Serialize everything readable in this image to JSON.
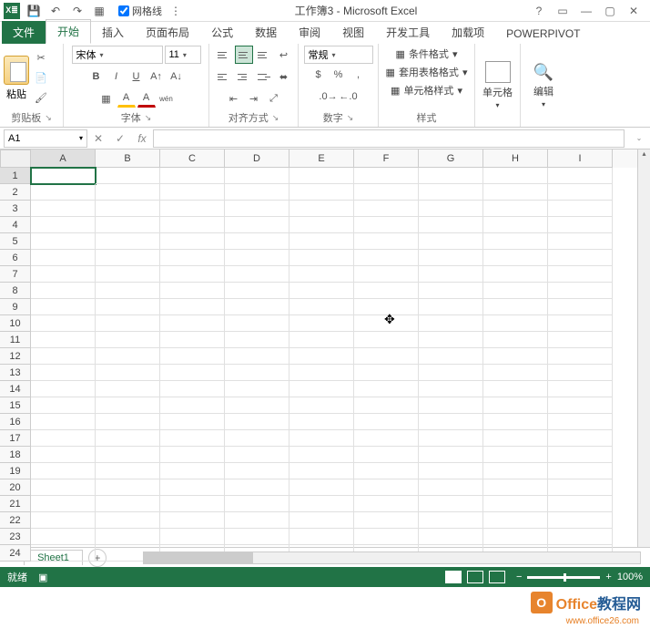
{
  "titlebar": {
    "gridlines_label": "网格线",
    "title": "工作簿3 - Microsoft Excel"
  },
  "tabs": {
    "file": "文件",
    "home": "开始",
    "insert": "插入",
    "pagelayout": "页面布局",
    "formulas": "公式",
    "data": "数据",
    "review": "审阅",
    "view": "视图",
    "developer": "开发工具",
    "addins": "加载项",
    "powerpivot": "POWERPIVOT"
  },
  "ribbon": {
    "clipboard": {
      "label": "剪贴板",
      "paste": "粘贴"
    },
    "font": {
      "label": "字体",
      "name": "宋体",
      "size": "11",
      "bold": "B",
      "italic": "I",
      "underline": "U",
      "phonetic": "wén",
      "phonetic2": "A"
    },
    "alignment": {
      "label": "对齐方式"
    },
    "number": {
      "label": "数字",
      "format": "常规"
    },
    "styles": {
      "label": "样式",
      "cond": "条件格式",
      "table": "套用表格格式",
      "cell": "单元格样式"
    },
    "cells": {
      "label": "单元格"
    },
    "editing": {
      "label": "编辑"
    }
  },
  "formula_bar": {
    "name_box": "A1",
    "fx": "fx"
  },
  "grid": {
    "cols": [
      "A",
      "B",
      "C",
      "D",
      "E",
      "F",
      "G",
      "H",
      "I"
    ],
    "rows": [
      "1",
      "2",
      "3",
      "4",
      "5",
      "6",
      "7",
      "8",
      "9",
      "10",
      "11",
      "12",
      "13",
      "14",
      "15",
      "16",
      "17",
      "18",
      "19",
      "20",
      "21",
      "22",
      "23",
      "24"
    ]
  },
  "sheets": {
    "active": "Sheet1"
  },
  "statusbar": {
    "ready": "就绪",
    "zoom": "100%"
  },
  "watermark": {
    "text1": "Office",
    "text2": "教程网",
    "url": "www.office26.com"
  }
}
